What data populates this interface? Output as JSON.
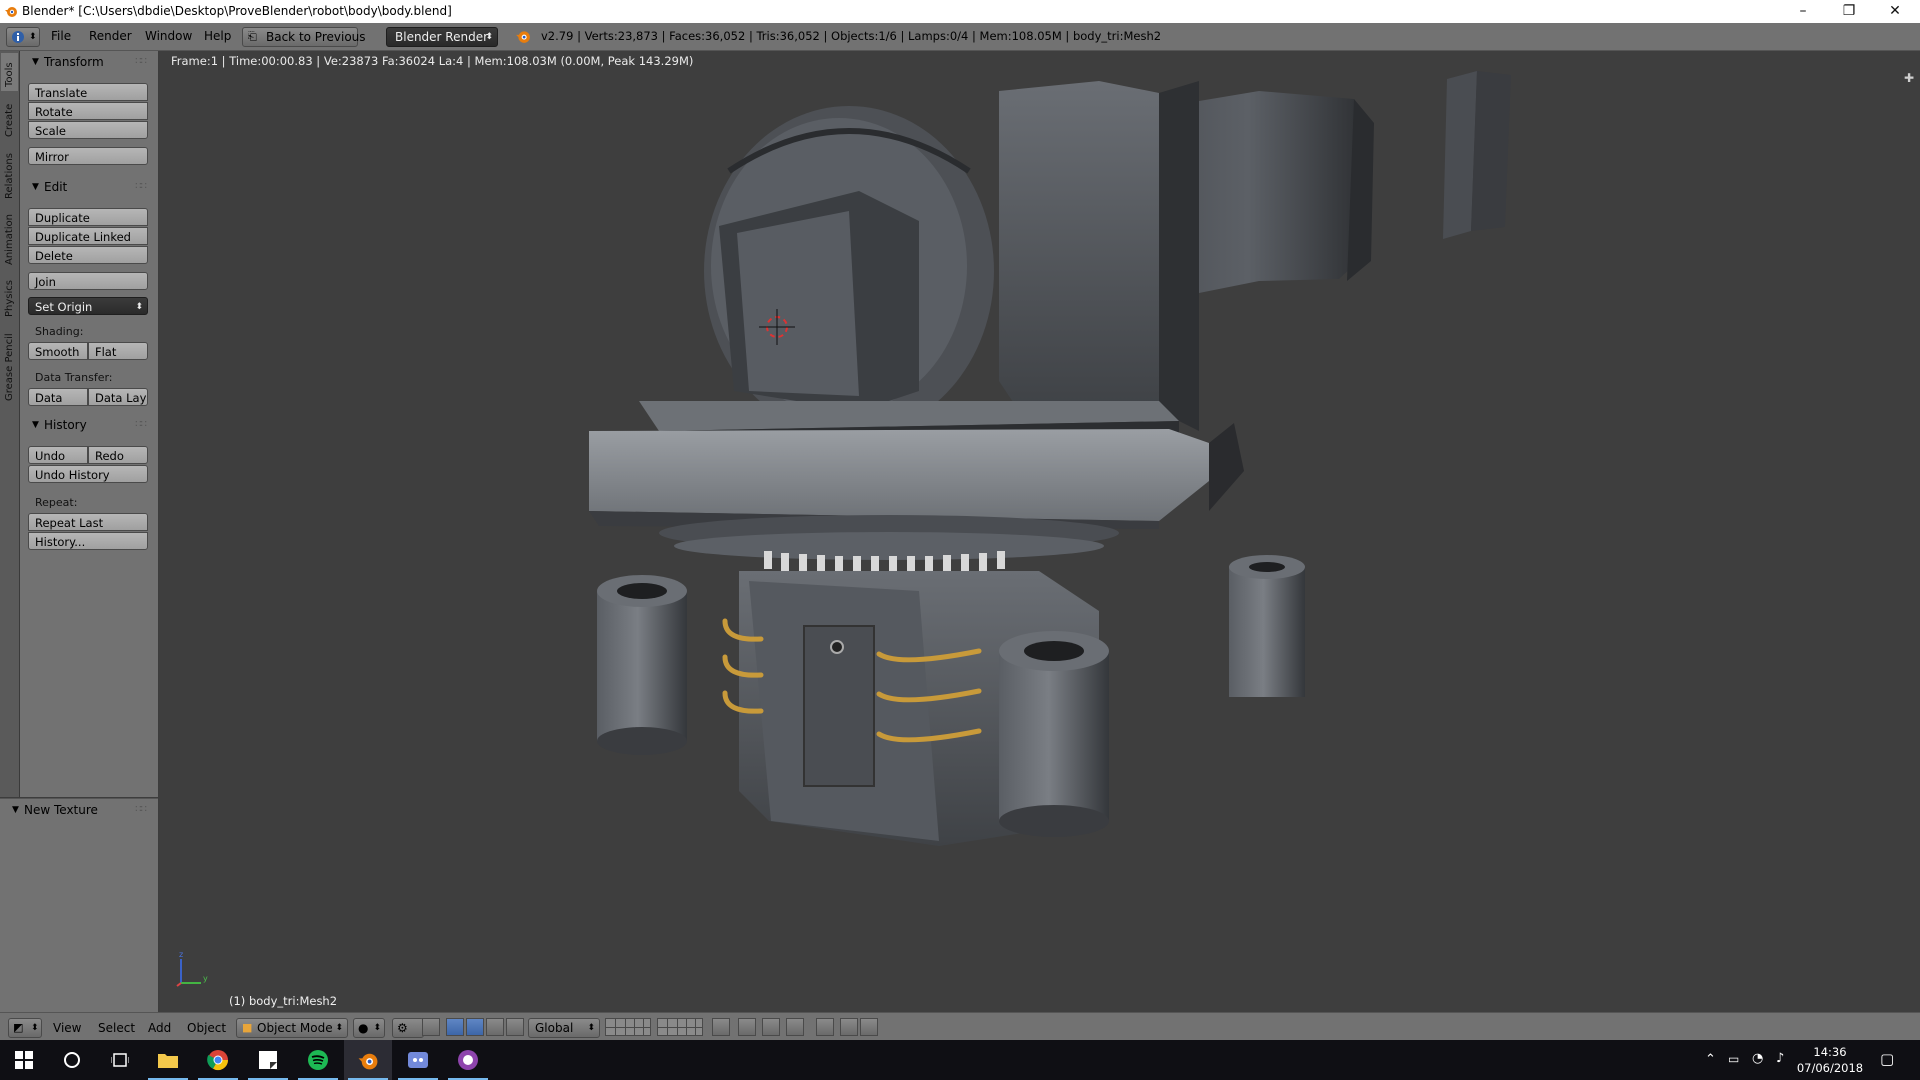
{
  "window": {
    "title": "Blender* [C:\\Users\\dbdie\\Desktop\\ProveBlender\\robot\\body\\body.blend]",
    "minimize_glyph": "–",
    "restore_glyph": "❐",
    "close_glyph": "✕"
  },
  "info_header": {
    "menus": [
      "File",
      "Render",
      "Window",
      "Help"
    ],
    "back_button": "Back to Previous",
    "render_engine": "Blender Render",
    "stats": "v2.79 | Verts:23,873 | Faces:36,052 | Tris:36,052 | Objects:1/6 | Lamps:0/4 | Mem:108.05M | body_tri:Mesh2"
  },
  "tabs": [
    "Tools",
    "Create",
    "Relations",
    "Animation",
    "Physics",
    "Grease Pencil"
  ],
  "toolshelf": {
    "transform": {
      "title": "Transform",
      "buttons": [
        "Translate",
        "Rotate",
        "Scale",
        "Mirror"
      ]
    },
    "edit": {
      "title": "Edit",
      "buttons": [
        "Duplicate",
        "Duplicate Linked",
        "Delete",
        "Join"
      ],
      "set_origin": "Set Origin",
      "shading_label": "Shading:",
      "shading_smooth": "Smooth",
      "shading_flat": "Flat",
      "data_transfer_label": "Data Transfer:",
      "data": "Data",
      "data_layout": "Data Layo"
    },
    "history": {
      "title": "History",
      "undo": "Undo",
      "redo": "Redo",
      "undo_history": "Undo History",
      "repeat_label": "Repeat:",
      "repeat_last": "Repeat Last",
      "history_dots": "History..."
    }
  },
  "lower_panel": {
    "title": "New Texture"
  },
  "viewport": {
    "info": "Frame:1 | Time:00:00.83 | Ve:23873 Fa:36024 La:4 | Mem:108.03M (0.00M, Peak 143.29M)",
    "object_label": "(1) body_tri:Mesh2",
    "axis_z": "z",
    "axis_y": "y"
  },
  "view_header": {
    "menus": [
      "View",
      "Select",
      "Add",
      "Object"
    ],
    "mode": "Object Mode",
    "orientation": "Global"
  },
  "taskbar": {
    "time": "14:36",
    "date": "07/06/2018"
  },
  "colors": {
    "panel_bg": "#727272",
    "viewport_bg": "#3e3e3e",
    "taskbar_bg": "#0f0f14",
    "accent_blue": "#5f86c4",
    "blender_orange": "#e87d0d"
  }
}
